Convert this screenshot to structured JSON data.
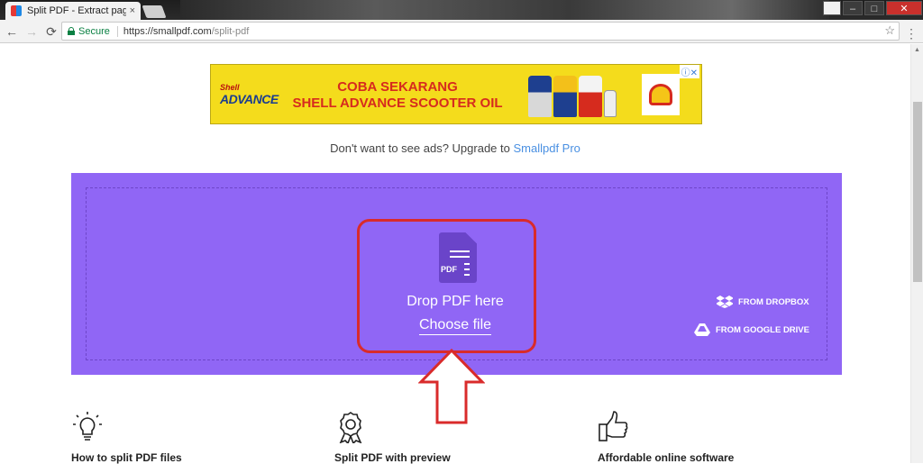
{
  "browser": {
    "tab_title": "Split PDF - Extract pages",
    "tab_close": "×",
    "security_label": "Secure",
    "url_host": "https://smallpdf.com",
    "url_path": "/split-pdf",
    "back": "←",
    "forward": "→",
    "reload": "⟳",
    "star": "☆",
    "menu": "⋮",
    "window": {
      "minimize": "–",
      "maximize": "□",
      "close": "✕"
    }
  },
  "ad": {
    "brand_top": "Shell",
    "brand_bottom": "ADVANCE",
    "headline_1": "COBA SEKARANG",
    "headline_2": "SHELL ADVANCE SCOOTER OIL",
    "ad_marker": "ⓘ✕"
  },
  "upsell": {
    "text": "Don't want to see ads? Upgrade to ",
    "link": "Smallpdf Pro"
  },
  "dropzone": {
    "pdf_label": "PDF",
    "drop_text": "Drop PDF here",
    "choose_file": "Choose file",
    "from_dropbox": "FROM DROPBOX",
    "from_google_drive": "FROM GOOGLE DRIVE"
  },
  "features": [
    {
      "icon": "lightbulb-icon",
      "title": "How to split PDF files"
    },
    {
      "icon": "ribbon-badge-icon",
      "title": "Split PDF with preview"
    },
    {
      "icon": "thumbs-up-icon",
      "title": "Affordable online software"
    }
  ],
  "colors": {
    "dropzone_bg": "#9066f5",
    "annotation_red": "#d92b2b",
    "link_blue": "#4a90e2",
    "ad_yellow": "#f4dc1c"
  }
}
